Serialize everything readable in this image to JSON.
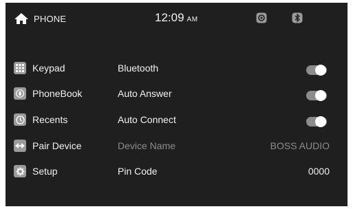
{
  "status_bar": {
    "home_icon": "home-icon",
    "title": "PHONE",
    "time": "12:09",
    "ampm": "AM",
    "icons": [
      "radio-icon",
      "bluetooth-icon"
    ]
  },
  "sidebar": {
    "items": [
      {
        "label": "Keypad",
        "icon": "keypad-icon"
      },
      {
        "label": "PhoneBook",
        "icon": "phonebook-icon"
      },
      {
        "label": "Recents",
        "icon": "clock-icon"
      },
      {
        "label": "Pair Device",
        "icon": "pair-device-icon"
      },
      {
        "label": "Setup",
        "icon": "gear-icon"
      }
    ]
  },
  "settings": {
    "bluetooth": {
      "label": "Bluetooth",
      "enabled": true
    },
    "auto_answer": {
      "label": "Auto Answer",
      "enabled": true
    },
    "auto_connect": {
      "label": "Auto Connect",
      "enabled": true
    },
    "device_name": {
      "label": "Device Name",
      "value": "BOSS AUDIO"
    },
    "pin_code": {
      "label": "Pin Code",
      "value": "0000"
    }
  },
  "colors": {
    "background": "#1f1f1f",
    "text": "#f2f2f2",
    "dim_text": "#8c8c8c",
    "toggle_track": "#8c8c8c",
    "toggle_knob": "#ffffff",
    "icon_tile": "#9a9a9a"
  }
}
